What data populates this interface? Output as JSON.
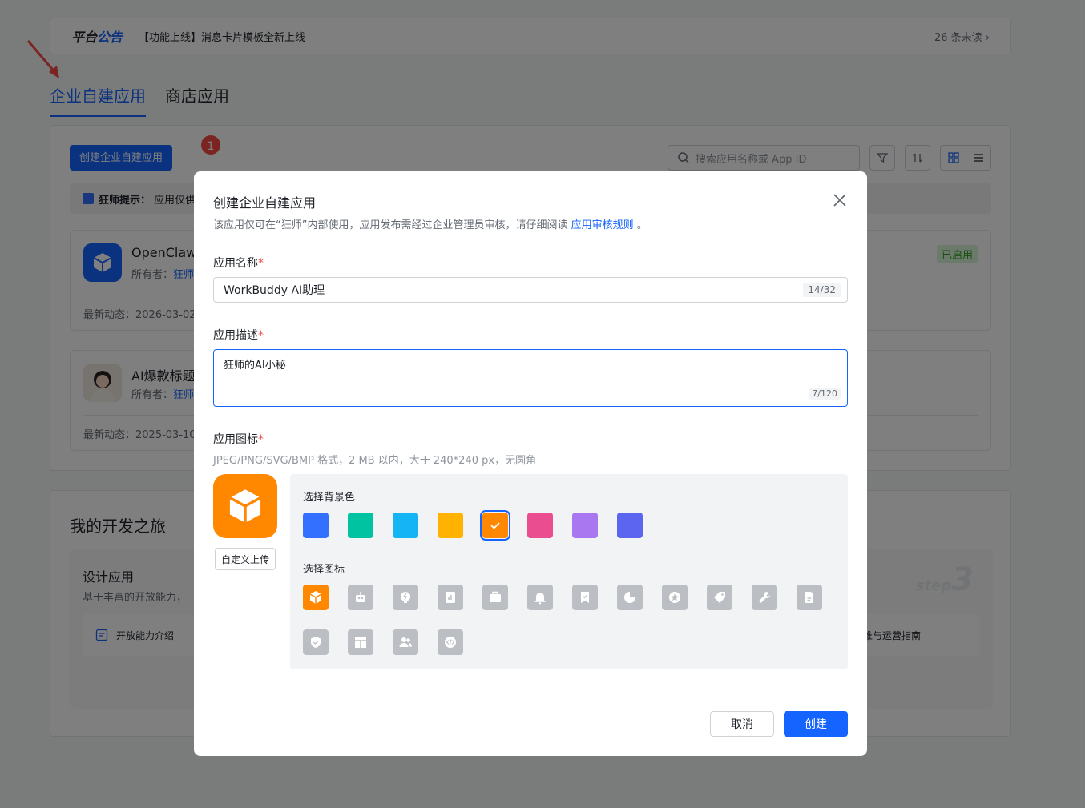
{
  "notice": {
    "brand_plain": "平台",
    "brand_accent": "公告",
    "text": "【功能上线】消息卡片模板全新上线",
    "unread": "26 条未读 ›"
  },
  "tabs": [
    {
      "label": "企业自建应用",
      "active": true
    },
    {
      "label": "商店应用",
      "active": false
    }
  ],
  "toolbar": {
    "create_label": "创建企业自建应用",
    "step_badge": "1",
    "search_placeholder": "搜索应用名称或 App ID"
  },
  "tip": {
    "title": "狂师提示：",
    "text": "应用仅供"
  },
  "apps": [
    {
      "name": "OpenClaw",
      "owner_label": "所有者：",
      "owner": "狂师",
      "latest": "最新动态：2026-03-02",
      "status": "已启用",
      "icon_color": "#1664ff"
    },
    {
      "name": "AI爆款标题",
      "owner_label": "所有者：",
      "owner": "狂师",
      "latest": "最新动态：2025-03-10"
    }
  ],
  "journey": {
    "title": "我的开发之旅",
    "step_title": "设计应用",
    "step_desc": "基于丰富的开放能力，",
    "link_left": "开放能力介绍",
    "link_right": "运维与运营指南",
    "step_word": "step",
    "step_num": "3"
  },
  "modal": {
    "title": "创建企业自建应用",
    "subtitle": "该应用仅可在“狂师”内部使用，应用发布需经过企业管理员审核，请仔细阅读",
    "subtitle_link": "应用审核规则",
    "subtitle_end": "。",
    "name_label": "应用名称",
    "name_value": "WorkBuddy AI助理",
    "name_counter": "14/32",
    "desc_label": "应用描述",
    "desc_value": "狂师的AI小秘",
    "desc_counter": "7/120",
    "icon_label": "应用图标",
    "icon_hint": "JPEG/PNG/SVG/BMP 格式，2 MB 以内，大于 240*240 px，无圆角",
    "upload_label": "自定义上传",
    "bg_label": "选择背景色",
    "icon_pick_label": "选择图标",
    "required_mark": "*",
    "cancel_label": "取消",
    "create_label": "创建"
  },
  "bg_colors": [
    "#3370ff",
    "#00c3a1",
    "#14b4f5",
    "#ffb200",
    "#ff8800",
    "#ea4e90",
    "#a977f0",
    "#5b65f0"
  ],
  "selected_bg_index": 4,
  "icons": [
    "cube-icon",
    "robot-icon",
    "bulb-icon",
    "document-chart-icon",
    "briefcase-icon",
    "bell-icon",
    "bookmark-check-icon",
    "pie-chart-icon",
    "star-badge-icon",
    "tag-icon",
    "wrench-icon",
    "file-icon",
    "shield-icon",
    "layout-icon",
    "users-icon",
    "code-icon"
  ],
  "selected_icon_index": 0
}
